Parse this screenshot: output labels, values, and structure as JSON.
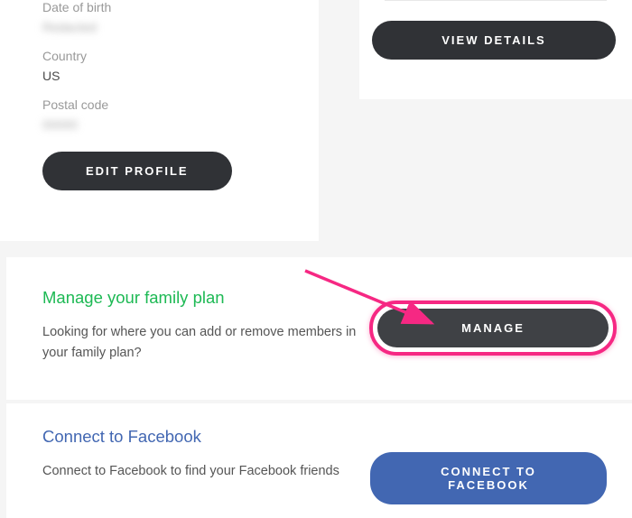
{
  "profile": {
    "dob_label": "Date of birth",
    "dob_value": "Redacted",
    "country_label": "Country",
    "country_value": "US",
    "postal_label": "Postal code",
    "postal_value": "00000",
    "edit_button": "EDIT PROFILE"
  },
  "rightCard": {
    "view_details": "VIEW DETAILS"
  },
  "family": {
    "title": "Manage your family plan",
    "description": "Looking for where you can add or remove members in your family plan?",
    "manage_button": "MANAGE"
  },
  "facebook": {
    "title": "Connect to Facebook",
    "description": "Connect to Facebook to find your Facebook friends",
    "connect_button": "CONNECT TO FACEBOOK"
  }
}
